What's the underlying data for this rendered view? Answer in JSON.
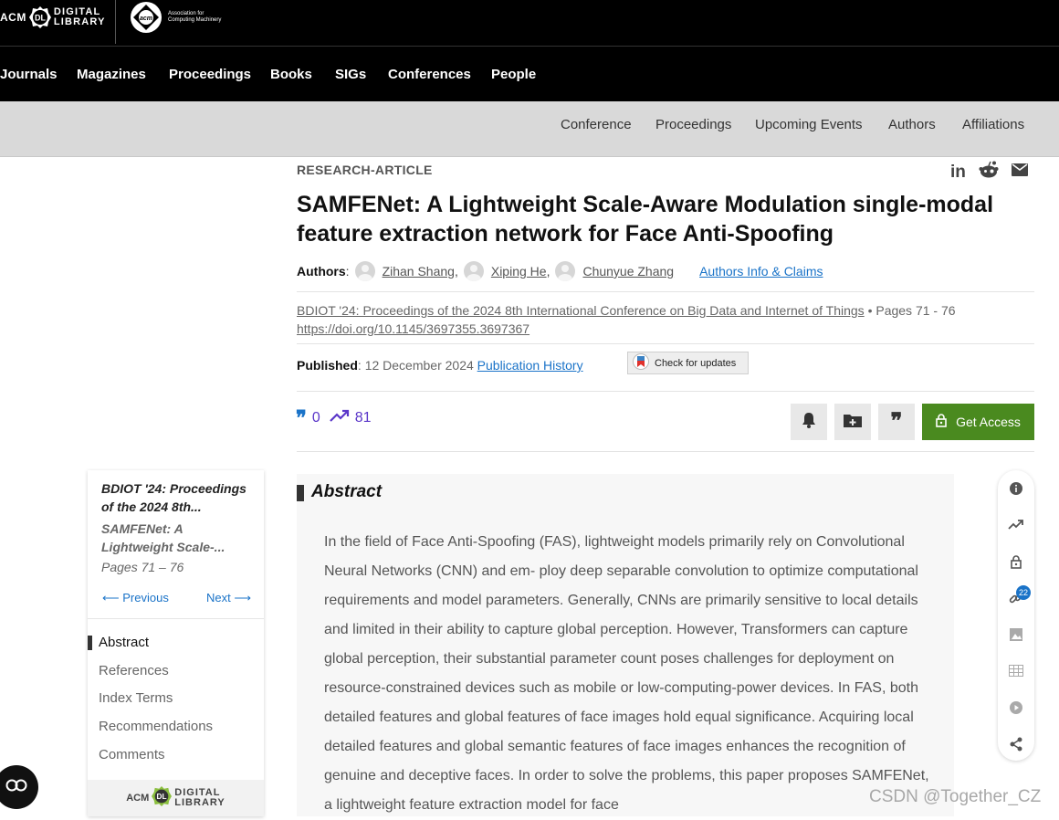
{
  "header": {
    "logo_acm": "ACM",
    "logo_dl_badge": "DL",
    "logo_digital": "DIGITAL",
    "logo_library": "LIBRARY",
    "assoc_line1": "Association for",
    "assoc_line2": "Computing Machinery"
  },
  "nav": [
    "Journals",
    "Magazines",
    "Proceedings",
    "Books",
    "SIGs",
    "Conferences",
    "People"
  ],
  "subnav": [
    "Conference",
    "Proceedings",
    "Upcoming Events",
    "Authors",
    "Affiliations"
  ],
  "article": {
    "type": "RESEARCH-ARTICLE",
    "title": "SAMFENet: A Lightweight Scale-Aware Modulation single-modal feature extraction network for Face Anti-Spoofing",
    "authors_label": "Authors",
    "authors": [
      "Zihan Shang",
      "Xiping He",
      "Chunyue Zhang"
    ],
    "authors_info": "Authors Info & Claims",
    "venue": "BDIOT '24: Proceedings of the 2024 8th International Conference on Big Data and Internet of Things",
    "pages": "Pages 71 - 76",
    "doi": "https://doi.org/10.1145/3697355.3697367",
    "published_label": "Published",
    "published_date": "12 December 2024",
    "publication_history": "Publication History",
    "check_updates": "Check for updates",
    "citations": "0",
    "downloads": "81",
    "get_access": "Get Access"
  },
  "sidebar": {
    "proceedings": "BDIOT '24: Proceedings of the 2024 8th...",
    "article_short": "SAMFENet: A Lightweight Scale-...",
    "pages": "Pages 71 – 76",
    "previous": "Previous",
    "next": "Next",
    "toc": [
      "Abstract",
      "References",
      "Index Terms",
      "Recommendations",
      "Comments"
    ]
  },
  "abstract": {
    "heading": "Abstract",
    "text": "In the field of Face Anti-Spoofing (FAS), lightweight models primarily rely on Convolutional Neural Networks (CNN) and em- ploy deep separable convolution to optimize computational requirements and model parameters. Generally, CNNs are primarily sensitive to local details and limited in their ability to capture global perception. However, Transformers can capture global perception, their substantial parameter count poses challenges for deployment on resource-constrained devices such as mobile or low-computing-power devices. In FAS, both detailed features and global features of face images hold equal significance. Acquiring local detailed features and global semantic features of face images enhances the recognition of genuine and deceptive faces. In order to solve the problems, this paper proposes SAMFENet, a lightweight feature extraction model for face"
  },
  "rail": {
    "link_count": "22"
  },
  "watermark": "CSDN @Together_CZ",
  "colors": {
    "accent_blue": "#1a73c8",
    "metric_purple": "#5b37c9",
    "access_green": "#4a8a1f"
  }
}
